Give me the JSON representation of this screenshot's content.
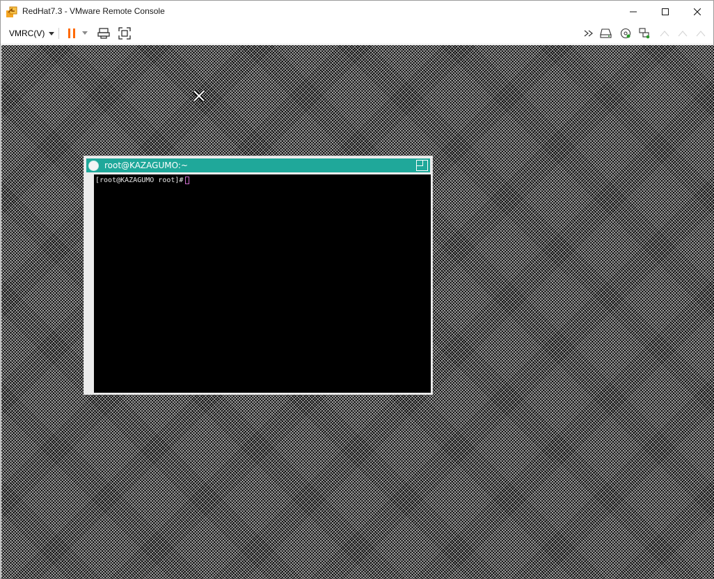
{
  "window": {
    "title": "RedHat7.3 - VMware Remote Console",
    "icon": "vmrc-app-icon"
  },
  "toolbar": {
    "menu_label": "VMRC(V)",
    "pause_icon": "pause-icon",
    "colors": {
      "pause": "#ff6a00"
    }
  },
  "xterm": {
    "title": "root@KAZAGUMO:~",
    "prompt": "[root@KAZAGUMO root]#",
    "colors": {
      "titlebar": "#1fa89a",
      "cursor": "#d070d0"
    }
  }
}
